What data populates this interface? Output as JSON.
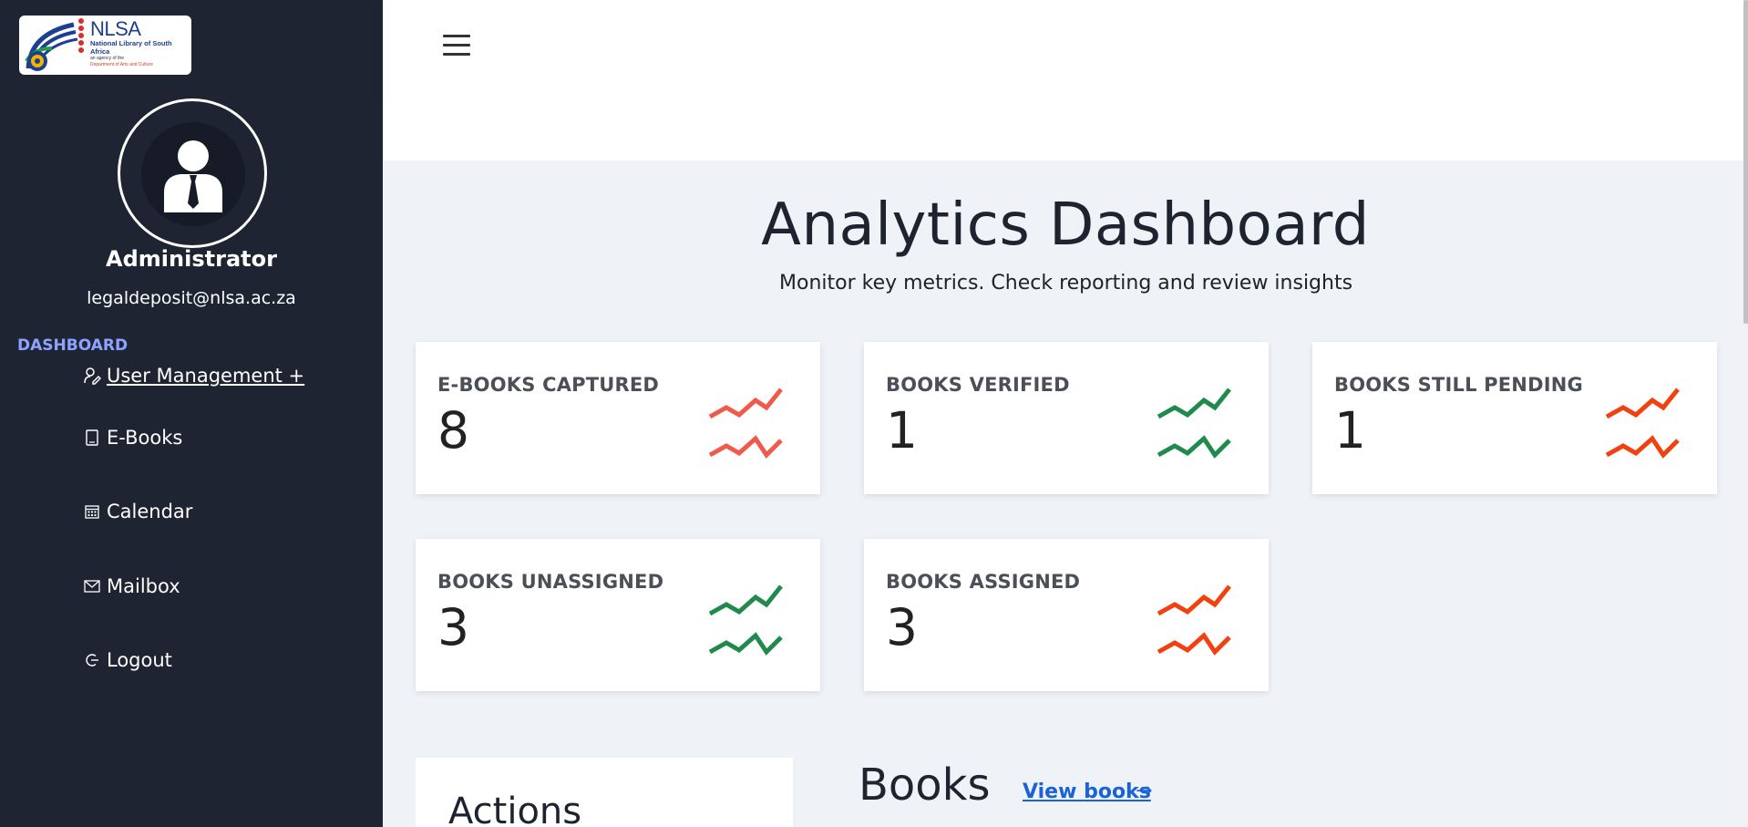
{
  "sidebar": {
    "logo": {
      "title": "NLSA",
      "subtitle": "National Library of South Africa",
      "agency_line": "an agency of the",
      "department": "Department of Arts and Culture"
    },
    "user": {
      "name": "Administrator",
      "email": "legaldeposit@nlsa.ac.za"
    },
    "section_label": "DASHBOARD",
    "items": [
      {
        "label": "User Management +",
        "icon": "user-edit-icon"
      },
      {
        "label": "E-Books",
        "icon": "book-icon"
      },
      {
        "label": "Calendar",
        "icon": "calendar-icon"
      },
      {
        "label": "Mailbox",
        "icon": "mail-icon"
      },
      {
        "label": "Logout",
        "icon": "logout-icon"
      }
    ]
  },
  "header": {
    "menu_icon": "hamburger-icon"
  },
  "main": {
    "title": "Analytics Dashboard",
    "subtitle": "Monitor key metrics. Check reporting and review insights",
    "cards": [
      {
        "label": "E-BOOKS CAPTURED",
        "value": "8",
        "color": "#f05a4a"
      },
      {
        "label": "BOOKS VERIFIED",
        "value": "1",
        "color": "#1f8a4c"
      },
      {
        "label": "BOOKS STILL PENDING",
        "value": "1",
        "color": "#f3400f"
      },
      {
        "label": "BOOKS UNASSIGNED",
        "value": "3",
        "color": "#1f8a4c"
      },
      {
        "label": "BOOKS ASSIGNED",
        "value": "3",
        "color": "#f3400f"
      }
    ],
    "actions_title": "Actions",
    "books_title": "Books",
    "view_books_link": "View books",
    "view_books_arrow": "→"
  }
}
